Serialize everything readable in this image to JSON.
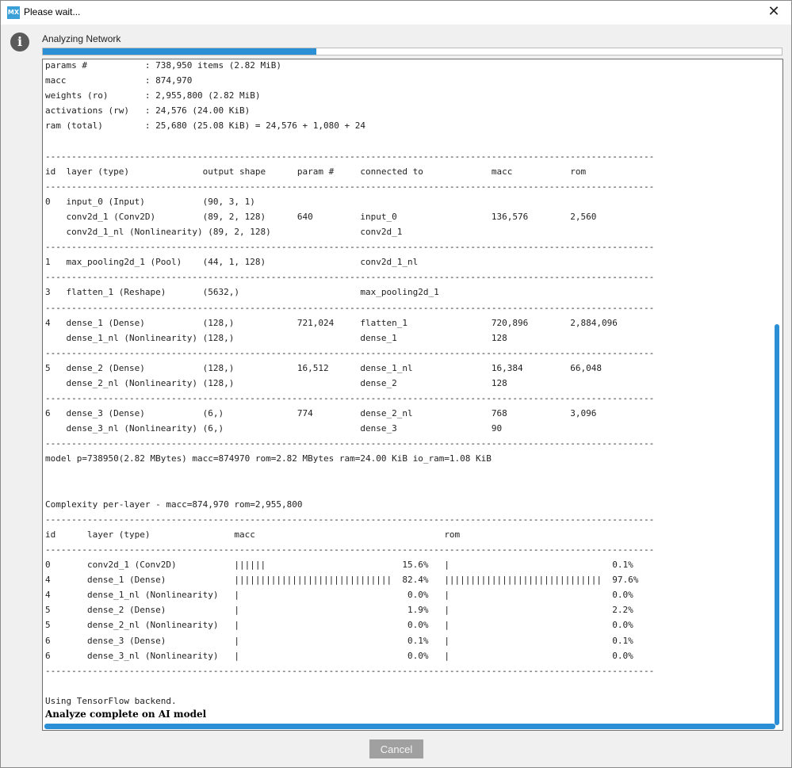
{
  "window": {
    "app_icon": "MX",
    "title": "Please wait...",
    "close_glyph": "✕",
    "info_glyph": "i"
  },
  "status": {
    "label": "Analyzing Network",
    "progress_fraction": 0.37
  },
  "colors": {
    "accent": "#2b8fd6",
    "cancel_bg": "#a0a0a0",
    "titlebar_bg": "#ffffff"
  },
  "console": {
    "lines": [
      "params #           : 738,950 items (2.82 MiB)",
      "macc               : 874,970",
      "weights (ro)       : 2,955,800 (2.82 MiB)",
      "activations (rw)   : 24,576 (24.00 KiB)",
      "ram (total)        : 25,680 (25.08 KiB) = 24,576 + 1,080 + 24",
      "",
      "--------------------------------------------------------------------------------------------------------------------",
      "id  layer (type)              output shape      param #     connected to             macc           rom",
      "--------------------------------------------------------------------------------------------------------------------",
      "0   input_0 (Input)           (90, 3, 1)",
      "    conv2d_1 (Conv2D)         (89, 2, 128)      640         input_0                  136,576        2,560",
      "    conv2d_1_nl (Nonlinearity) (89, 2, 128)                 conv2d_1",
      "--------------------------------------------------------------------------------------------------------------------",
      "1   max_pooling2d_1 (Pool)    (44, 1, 128)                  conv2d_1_nl",
      "--------------------------------------------------------------------------------------------------------------------",
      "3   flatten_1 (Reshape)       (5632,)                       max_pooling2d_1",
      "--------------------------------------------------------------------------------------------------------------------",
      "4   dense_1 (Dense)           (128,)            721,024     flatten_1                720,896        2,884,096",
      "    dense_1_nl (Nonlinearity) (128,)                        dense_1                  128",
      "--------------------------------------------------------------------------------------------------------------------",
      "5   dense_2 (Dense)           (128,)            16,512      dense_1_nl               16,384         66,048",
      "    dense_2_nl (Nonlinearity) (128,)                        dense_2                  128",
      "--------------------------------------------------------------------------------------------------------------------",
      "6   dense_3 (Dense)           (6,)              774         dense_2_nl               768            3,096",
      "    dense_3_nl (Nonlinearity) (6,)                          dense_3                  90",
      "--------------------------------------------------------------------------------------------------------------------",
      "model p=738950(2.82 MBytes) macc=874970 rom=2.82 MBytes ram=24.00 KiB io_ram=1.08 KiB",
      "",
      "",
      "Complexity per-layer - macc=874,970 rom=2,955,800",
      "--------------------------------------------------------------------------------------------------------------------",
      "id      layer (type)                macc                                    rom",
      "--------------------------------------------------------------------------------------------------------------------",
      "0       conv2d_1 (Conv2D)           ||||||                          15.6%   |                               0.1%",
      "4       dense_1 (Dense)             ||||||||||||||||||||||||||||||  82.4%   ||||||||||||||||||||||||||||||  97.6%",
      "4       dense_1_nl (Nonlinearity)   |                                0.0%   |                               0.0%",
      "5       dense_2 (Dense)             |                                1.9%   |                               2.2%",
      "5       dense_2_nl (Nonlinearity)   |                                0.0%   |                               0.0%",
      "6       dense_3 (Dense)             |                                0.1%   |                               0.1%",
      "6       dense_3_nl (Nonlinearity)   |                                0.0%   |                               0.0%",
      "--------------------------------------------------------------------------------------------------------------------",
      "",
      "Using TensorFlow backend."
    ],
    "final_line": "Analyze complete on AI model"
  },
  "buttons": {
    "cancel": "Cancel"
  }
}
